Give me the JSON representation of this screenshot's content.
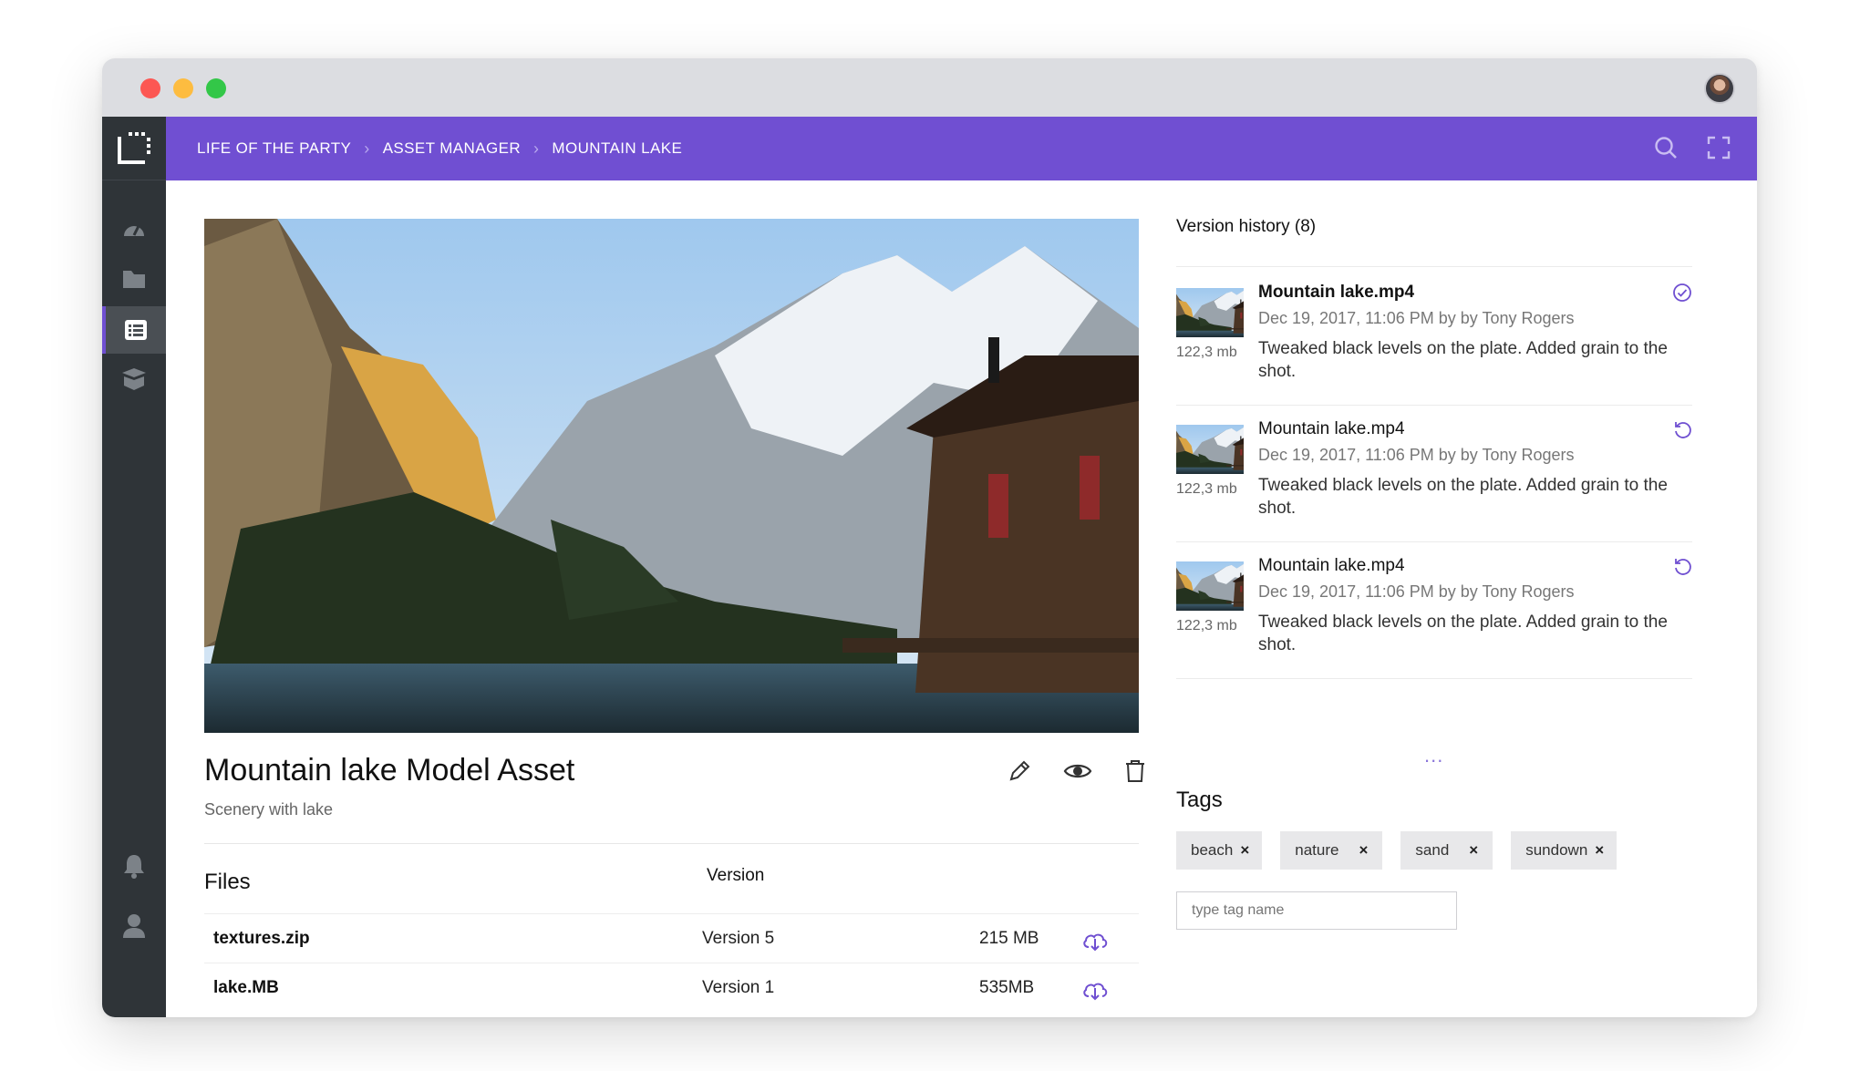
{
  "breadcrumb": [
    "LIFE OF THE PARTY",
    "ASSET MANAGER",
    "MOUNTAIN LAKE"
  ],
  "sidebar": {
    "items": [
      {
        "icon": "dashboard-icon"
      },
      {
        "icon": "folder-icon"
      },
      {
        "icon": "list-icon",
        "active": true
      },
      {
        "icon": "box-icon"
      }
    ],
    "bottom": [
      {
        "icon": "bell-icon"
      },
      {
        "icon": "user-icon"
      }
    ]
  },
  "asset": {
    "title": "Mountain lake Model Asset",
    "subtitle": "Scenery with lake"
  },
  "files": {
    "heading": "Files",
    "version_header": "Version",
    "rows": [
      {
        "name": "textures.zip",
        "version": "Version 5",
        "size": "215 MB"
      },
      {
        "name": "lake.MB",
        "version": "Version 1",
        "size": "535MB"
      }
    ]
  },
  "version_history": {
    "title": "Version history (8)",
    "items": [
      {
        "name": "Mountain lake.mp4",
        "date": "Dec 19, 2017, 11:06 PM by by Tony Rogers",
        "description": "Tweaked black levels on the plate. Added grain to the shot.",
        "size": "122,3 mb",
        "icon": "check-circle-icon"
      },
      {
        "name": "Mountain lake.mp4",
        "date": "Dec 19, 2017, 11:06 PM by by Tony Rogers",
        "description": "Tweaked black levels on the plate. Added grain to the shot.",
        "size": "122,3 mb",
        "icon": "revert-icon"
      },
      {
        "name": "Mountain lake.mp4",
        "date": "Dec 19, 2017, 11:06 PM by by Tony Rogers",
        "description": "Tweaked black levels on the plate. Added grain to the shot.",
        "size": "122,3 mb",
        "icon": "revert-icon"
      }
    ],
    "more": "..."
  },
  "tags": {
    "title": "Tags",
    "items": [
      "beach",
      "nature",
      "sand",
      "sundown"
    ],
    "remove_glyph": "×",
    "input_placeholder": "type tag name"
  },
  "colors": {
    "accent": "#704fd2",
    "sidebar": "#2f3438",
    "titlebar": "#dcdde1"
  }
}
